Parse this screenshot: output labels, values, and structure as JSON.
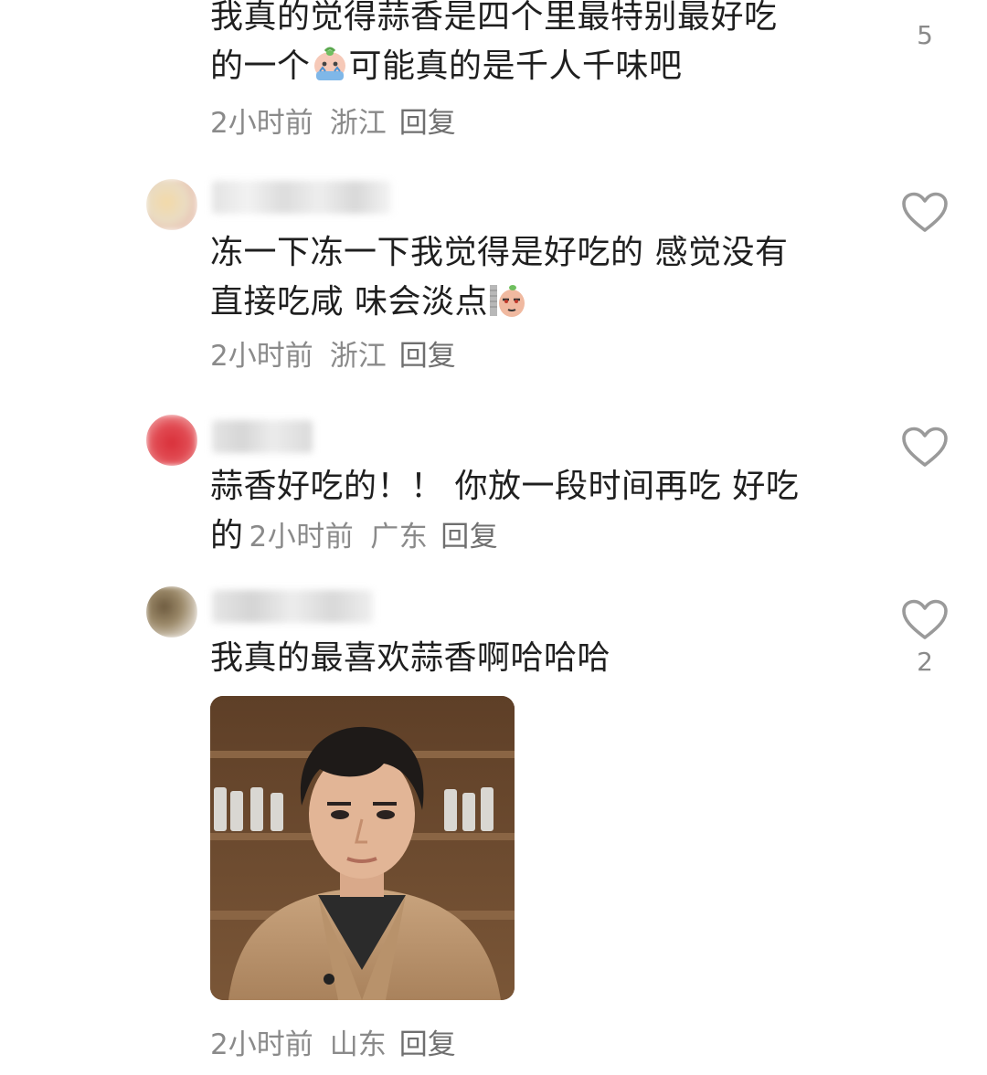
{
  "comments": [
    {
      "text_line1": "我真的觉得蒜香是四个里最特别最好吃",
      "text_line2_a": "的一个",
      "text_line2_b": "可能真的是千人千味吧",
      "emoji": "crying-face-emoji",
      "time": "2小时前",
      "location": "浙江",
      "reply": "回复",
      "likes": "5"
    },
    {
      "text_line1": "冻一下冻一下我觉得是好吃的 感觉没有",
      "text_line2": "直接吃咸 味会淡点",
      "emoji": "smirk-face-emoji",
      "time": "2小时前",
      "location": "浙江",
      "reply": "回复",
      "likes": ""
    },
    {
      "text_line1": "蒜香好吃的！！ 你放一段时间再吃 好吃",
      "text_line2": "的",
      "time": "2小时前",
      "location": "广东",
      "reply": "回复",
      "likes": ""
    },
    {
      "text_line1": "我真的最喜欢蒜香啊哈哈哈",
      "time": "2小时前",
      "location": "山东",
      "reply": "回复",
      "likes": "2",
      "image": "portrait-photo"
    }
  ],
  "icons": {
    "like": "heart-outline-icon"
  },
  "colors": {
    "text": "#1f1f1f",
    "meta": "#8a8a8a",
    "icon": "#9a9a9a"
  }
}
